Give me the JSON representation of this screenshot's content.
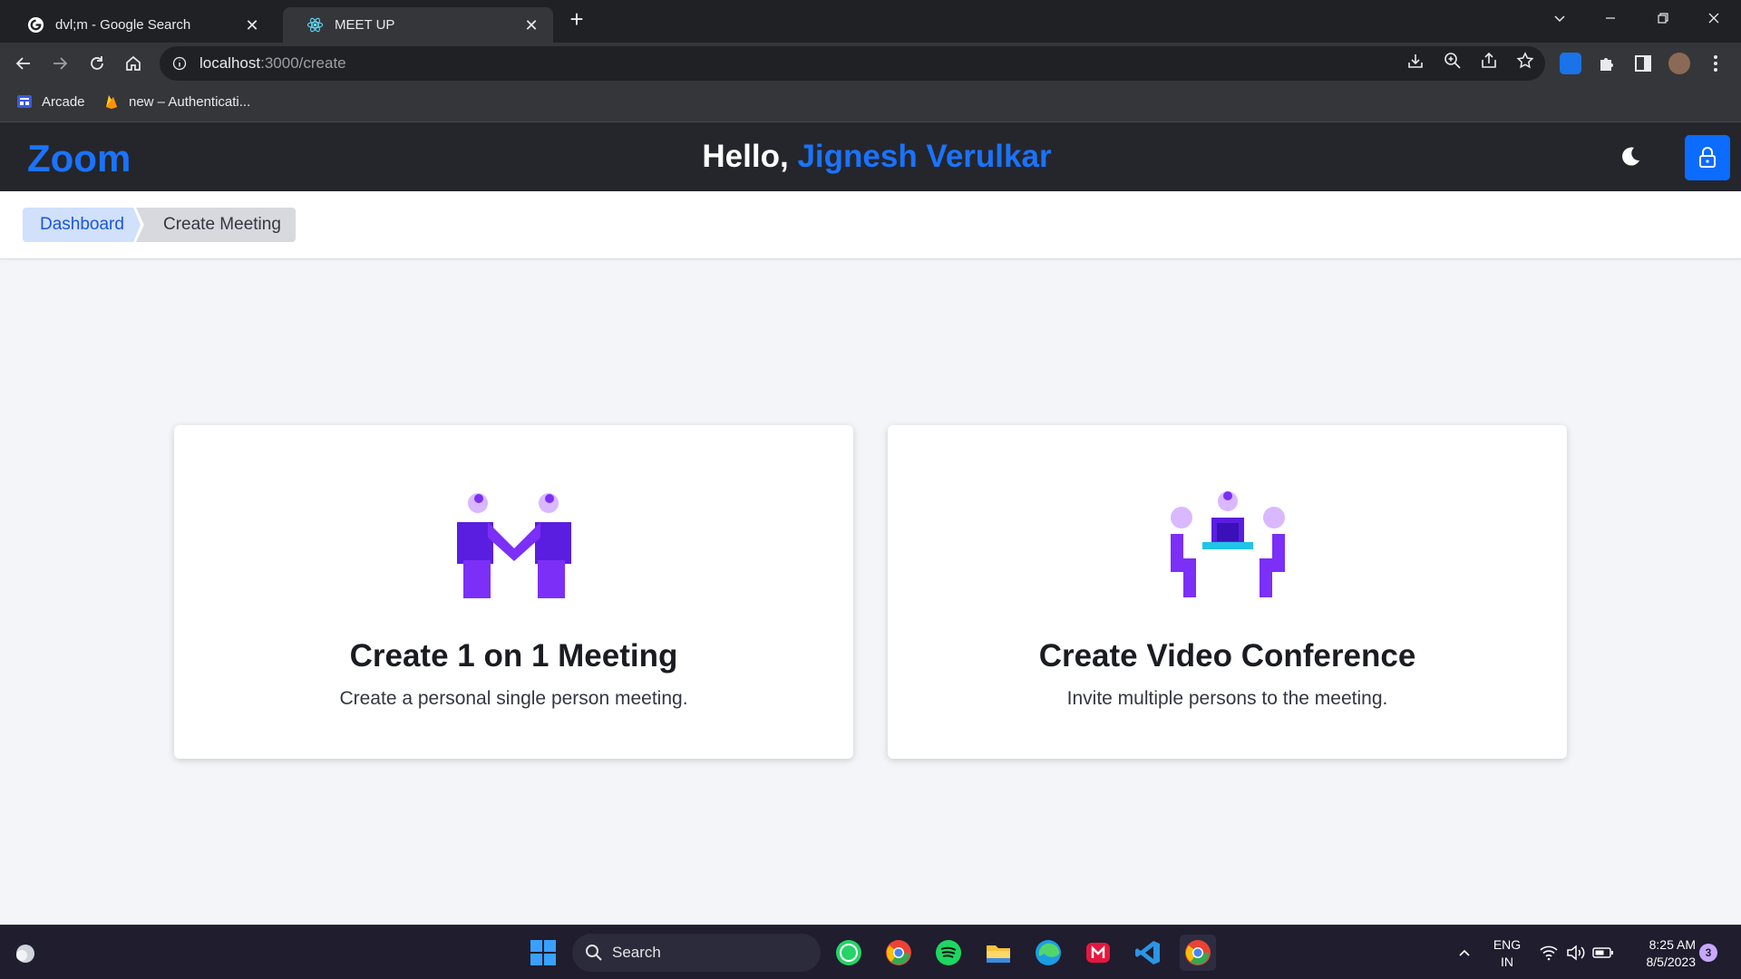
{
  "browser": {
    "tabs": [
      {
        "title": "dvl;m - Google Search",
        "favicon": "google-icon",
        "active": false
      },
      {
        "title": "MEET UP",
        "favicon": "react-icon",
        "active": true
      }
    ],
    "new_tab": "+",
    "address": {
      "host": "localhost",
      "path": ":3000/create"
    },
    "bookmarks": [
      {
        "label": "Arcade",
        "icon": "arcade-icon"
      },
      {
        "label": "new – Authenticati...",
        "icon": "firebase-icon"
      }
    ]
  },
  "app": {
    "logo": "Zoom",
    "greeting_prefix": "Hello, ",
    "user_name": "Jignesh Verulkar",
    "theme_icon": "moon-icon",
    "logout_icon": "lock-icon"
  },
  "breadcrumb": [
    {
      "label": "Dashboard"
    },
    {
      "label": "Create Meeting"
    }
  ],
  "cards": [
    {
      "title": "Create 1 on 1 Meeting",
      "description": "Create a personal single person meeting.",
      "icon": "one-on-one-meeting-illustration"
    },
    {
      "title": "Create Video Conference",
      "description": "Invite multiple persons to the meeting.",
      "icon": "video-conference-illustration"
    }
  ],
  "taskbar": {
    "search_placeholder": "Search",
    "language": "ENG",
    "region": "IN",
    "time": "8:25 AM",
    "date": "8/5/2023",
    "notifications": "3"
  },
  "colors": {
    "accent": "#1a73ff",
    "header_bg": "#25262b",
    "illustration_primary": "#7b2ff7",
    "illustration_light": "#d9b8ff"
  }
}
